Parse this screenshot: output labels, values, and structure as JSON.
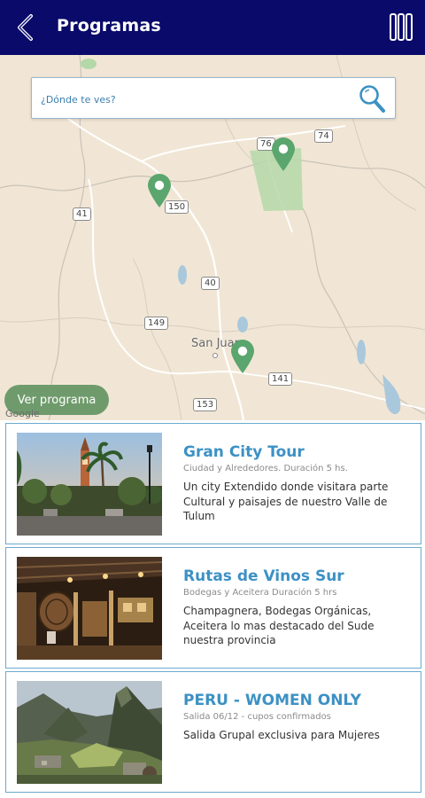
{
  "header": {
    "title": "Programas",
    "back_icon": "chevron-left-icon",
    "menu_icon": "columns-menu-icon",
    "background": "#0a0a6b"
  },
  "map": {
    "search": {
      "placeholder": "¿Dónde te ves?"
    },
    "roads": [
      "76",
      "74",
      "150",
      "41",
      "40",
      "149",
      "141",
      "153"
    ],
    "city": "San Juan",
    "pin_color": "#5aa66e",
    "cta_label": "Ver programa",
    "attribution": "Google"
  },
  "programs": [
    {
      "title": "Gran City Tour",
      "subtitle": "Ciudad y Alrededores. Duración 5 hs.",
      "description": "Un city Extendido donde visitara parte Cultural y paisajes de nuestro Valle de Tulum"
    },
    {
      "title": "Rutas de Vinos Sur",
      "subtitle": "Bodegas y Aceitera Duración 5 hrs",
      "description": "Champagnera, Bodegas Orgánicas, Aceitera lo mas destacado del Sude nuestra provincia"
    },
    {
      "title": "PERU - WOMEN ONLY",
      "subtitle": "Salida 06/12 - cupos confirmados",
      "description": "Salida Grupal exclusiva para Mujeres"
    }
  ],
  "colors": {
    "accent": "#3c91c4",
    "card_border": "#6da9cf"
  }
}
